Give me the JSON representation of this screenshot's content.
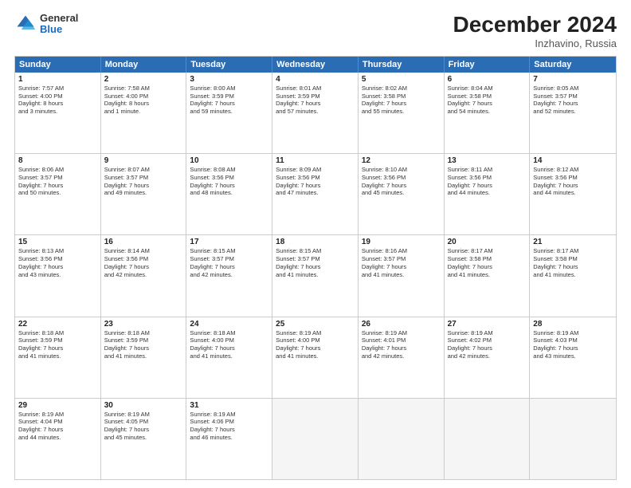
{
  "logo": {
    "general": "General",
    "blue": "Blue"
  },
  "title": "December 2024",
  "location": "Inzhavino, Russia",
  "days_of_week": [
    "Sunday",
    "Monday",
    "Tuesday",
    "Wednesday",
    "Thursday",
    "Friday",
    "Saturday"
  ],
  "weeks": [
    [
      {
        "day": 1,
        "lines": [
          "Sunrise: 7:57 AM",
          "Sunset: 4:00 PM",
          "Daylight: 8 hours",
          "and 3 minutes."
        ]
      },
      {
        "day": 2,
        "lines": [
          "Sunrise: 7:58 AM",
          "Sunset: 4:00 PM",
          "Daylight: 8 hours",
          "and 1 minute."
        ]
      },
      {
        "day": 3,
        "lines": [
          "Sunrise: 8:00 AM",
          "Sunset: 3:59 PM",
          "Daylight: 7 hours",
          "and 59 minutes."
        ]
      },
      {
        "day": 4,
        "lines": [
          "Sunrise: 8:01 AM",
          "Sunset: 3:59 PM",
          "Daylight: 7 hours",
          "and 57 minutes."
        ]
      },
      {
        "day": 5,
        "lines": [
          "Sunrise: 8:02 AM",
          "Sunset: 3:58 PM",
          "Daylight: 7 hours",
          "and 55 minutes."
        ]
      },
      {
        "day": 6,
        "lines": [
          "Sunrise: 8:04 AM",
          "Sunset: 3:58 PM",
          "Daylight: 7 hours",
          "and 54 minutes."
        ]
      },
      {
        "day": 7,
        "lines": [
          "Sunrise: 8:05 AM",
          "Sunset: 3:57 PM",
          "Daylight: 7 hours",
          "and 52 minutes."
        ]
      }
    ],
    [
      {
        "day": 8,
        "lines": [
          "Sunrise: 8:06 AM",
          "Sunset: 3:57 PM",
          "Daylight: 7 hours",
          "and 50 minutes."
        ]
      },
      {
        "day": 9,
        "lines": [
          "Sunrise: 8:07 AM",
          "Sunset: 3:57 PM",
          "Daylight: 7 hours",
          "and 49 minutes."
        ]
      },
      {
        "day": 10,
        "lines": [
          "Sunrise: 8:08 AM",
          "Sunset: 3:56 PM",
          "Daylight: 7 hours",
          "and 48 minutes."
        ]
      },
      {
        "day": 11,
        "lines": [
          "Sunrise: 8:09 AM",
          "Sunset: 3:56 PM",
          "Daylight: 7 hours",
          "and 47 minutes."
        ]
      },
      {
        "day": 12,
        "lines": [
          "Sunrise: 8:10 AM",
          "Sunset: 3:56 PM",
          "Daylight: 7 hours",
          "and 45 minutes."
        ]
      },
      {
        "day": 13,
        "lines": [
          "Sunrise: 8:11 AM",
          "Sunset: 3:56 PM",
          "Daylight: 7 hours",
          "and 44 minutes."
        ]
      },
      {
        "day": 14,
        "lines": [
          "Sunrise: 8:12 AM",
          "Sunset: 3:56 PM",
          "Daylight: 7 hours",
          "and 44 minutes."
        ]
      }
    ],
    [
      {
        "day": 15,
        "lines": [
          "Sunrise: 8:13 AM",
          "Sunset: 3:56 PM",
          "Daylight: 7 hours",
          "and 43 minutes."
        ]
      },
      {
        "day": 16,
        "lines": [
          "Sunrise: 8:14 AM",
          "Sunset: 3:56 PM",
          "Daylight: 7 hours",
          "and 42 minutes."
        ]
      },
      {
        "day": 17,
        "lines": [
          "Sunrise: 8:15 AM",
          "Sunset: 3:57 PM",
          "Daylight: 7 hours",
          "and 42 minutes."
        ]
      },
      {
        "day": 18,
        "lines": [
          "Sunrise: 8:15 AM",
          "Sunset: 3:57 PM",
          "Daylight: 7 hours",
          "and 41 minutes."
        ]
      },
      {
        "day": 19,
        "lines": [
          "Sunrise: 8:16 AM",
          "Sunset: 3:57 PM",
          "Daylight: 7 hours",
          "and 41 minutes."
        ]
      },
      {
        "day": 20,
        "lines": [
          "Sunrise: 8:17 AM",
          "Sunset: 3:58 PM",
          "Daylight: 7 hours",
          "and 41 minutes."
        ]
      },
      {
        "day": 21,
        "lines": [
          "Sunrise: 8:17 AM",
          "Sunset: 3:58 PM",
          "Daylight: 7 hours",
          "and 41 minutes."
        ]
      }
    ],
    [
      {
        "day": 22,
        "lines": [
          "Sunrise: 8:18 AM",
          "Sunset: 3:59 PM",
          "Daylight: 7 hours",
          "and 41 minutes."
        ]
      },
      {
        "day": 23,
        "lines": [
          "Sunrise: 8:18 AM",
          "Sunset: 3:59 PM",
          "Daylight: 7 hours",
          "and 41 minutes."
        ]
      },
      {
        "day": 24,
        "lines": [
          "Sunrise: 8:18 AM",
          "Sunset: 4:00 PM",
          "Daylight: 7 hours",
          "and 41 minutes."
        ]
      },
      {
        "day": 25,
        "lines": [
          "Sunrise: 8:19 AM",
          "Sunset: 4:00 PM",
          "Daylight: 7 hours",
          "and 41 minutes."
        ]
      },
      {
        "day": 26,
        "lines": [
          "Sunrise: 8:19 AM",
          "Sunset: 4:01 PM",
          "Daylight: 7 hours",
          "and 42 minutes."
        ]
      },
      {
        "day": 27,
        "lines": [
          "Sunrise: 8:19 AM",
          "Sunset: 4:02 PM",
          "Daylight: 7 hours",
          "and 42 minutes."
        ]
      },
      {
        "day": 28,
        "lines": [
          "Sunrise: 8:19 AM",
          "Sunset: 4:03 PM",
          "Daylight: 7 hours",
          "and 43 minutes."
        ]
      }
    ],
    [
      {
        "day": 29,
        "lines": [
          "Sunrise: 8:19 AM",
          "Sunset: 4:04 PM",
          "Daylight: 7 hours",
          "and 44 minutes."
        ]
      },
      {
        "day": 30,
        "lines": [
          "Sunrise: 8:19 AM",
          "Sunset: 4:05 PM",
          "Daylight: 7 hours",
          "and 45 minutes."
        ]
      },
      {
        "day": 31,
        "lines": [
          "Sunrise: 8:19 AM",
          "Sunset: 4:06 PM",
          "Daylight: 7 hours",
          "and 46 minutes."
        ]
      },
      null,
      null,
      null,
      null
    ]
  ]
}
